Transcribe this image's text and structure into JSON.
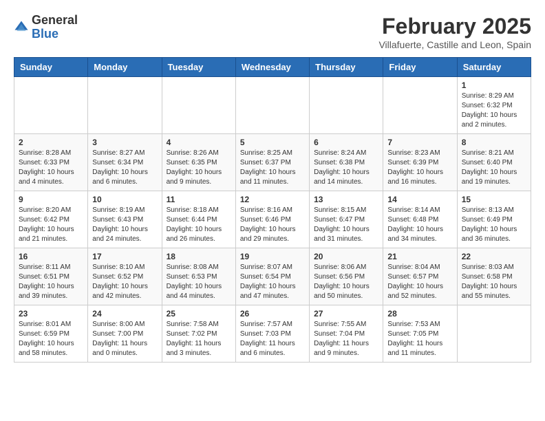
{
  "header": {
    "logo_general": "General",
    "logo_blue": "Blue",
    "month_year": "February 2025",
    "location": "Villafuerte, Castille and Leon, Spain"
  },
  "weekdays": [
    "Sunday",
    "Monday",
    "Tuesday",
    "Wednesday",
    "Thursday",
    "Friday",
    "Saturday"
  ],
  "weeks": [
    [
      {
        "day": "",
        "info": ""
      },
      {
        "day": "",
        "info": ""
      },
      {
        "day": "",
        "info": ""
      },
      {
        "day": "",
        "info": ""
      },
      {
        "day": "",
        "info": ""
      },
      {
        "day": "",
        "info": ""
      },
      {
        "day": "1",
        "info": "Sunrise: 8:29 AM\nSunset: 6:32 PM\nDaylight: 10 hours and 2 minutes."
      }
    ],
    [
      {
        "day": "2",
        "info": "Sunrise: 8:28 AM\nSunset: 6:33 PM\nDaylight: 10 hours and 4 minutes."
      },
      {
        "day": "3",
        "info": "Sunrise: 8:27 AM\nSunset: 6:34 PM\nDaylight: 10 hours and 6 minutes."
      },
      {
        "day": "4",
        "info": "Sunrise: 8:26 AM\nSunset: 6:35 PM\nDaylight: 10 hours and 9 minutes."
      },
      {
        "day": "5",
        "info": "Sunrise: 8:25 AM\nSunset: 6:37 PM\nDaylight: 10 hours and 11 minutes."
      },
      {
        "day": "6",
        "info": "Sunrise: 8:24 AM\nSunset: 6:38 PM\nDaylight: 10 hours and 14 minutes."
      },
      {
        "day": "7",
        "info": "Sunrise: 8:23 AM\nSunset: 6:39 PM\nDaylight: 10 hours and 16 minutes."
      },
      {
        "day": "8",
        "info": "Sunrise: 8:21 AM\nSunset: 6:40 PM\nDaylight: 10 hours and 19 minutes."
      }
    ],
    [
      {
        "day": "9",
        "info": "Sunrise: 8:20 AM\nSunset: 6:42 PM\nDaylight: 10 hours and 21 minutes."
      },
      {
        "day": "10",
        "info": "Sunrise: 8:19 AM\nSunset: 6:43 PM\nDaylight: 10 hours and 24 minutes."
      },
      {
        "day": "11",
        "info": "Sunrise: 8:18 AM\nSunset: 6:44 PM\nDaylight: 10 hours and 26 minutes."
      },
      {
        "day": "12",
        "info": "Sunrise: 8:16 AM\nSunset: 6:46 PM\nDaylight: 10 hours and 29 minutes."
      },
      {
        "day": "13",
        "info": "Sunrise: 8:15 AM\nSunset: 6:47 PM\nDaylight: 10 hours and 31 minutes."
      },
      {
        "day": "14",
        "info": "Sunrise: 8:14 AM\nSunset: 6:48 PM\nDaylight: 10 hours and 34 minutes."
      },
      {
        "day": "15",
        "info": "Sunrise: 8:13 AM\nSunset: 6:49 PM\nDaylight: 10 hours and 36 minutes."
      }
    ],
    [
      {
        "day": "16",
        "info": "Sunrise: 8:11 AM\nSunset: 6:51 PM\nDaylight: 10 hours and 39 minutes."
      },
      {
        "day": "17",
        "info": "Sunrise: 8:10 AM\nSunset: 6:52 PM\nDaylight: 10 hours and 42 minutes."
      },
      {
        "day": "18",
        "info": "Sunrise: 8:08 AM\nSunset: 6:53 PM\nDaylight: 10 hours and 44 minutes."
      },
      {
        "day": "19",
        "info": "Sunrise: 8:07 AM\nSunset: 6:54 PM\nDaylight: 10 hours and 47 minutes."
      },
      {
        "day": "20",
        "info": "Sunrise: 8:06 AM\nSunset: 6:56 PM\nDaylight: 10 hours and 50 minutes."
      },
      {
        "day": "21",
        "info": "Sunrise: 8:04 AM\nSunset: 6:57 PM\nDaylight: 10 hours and 52 minutes."
      },
      {
        "day": "22",
        "info": "Sunrise: 8:03 AM\nSunset: 6:58 PM\nDaylight: 10 hours and 55 minutes."
      }
    ],
    [
      {
        "day": "23",
        "info": "Sunrise: 8:01 AM\nSunset: 6:59 PM\nDaylight: 10 hours and 58 minutes."
      },
      {
        "day": "24",
        "info": "Sunrise: 8:00 AM\nSunset: 7:00 PM\nDaylight: 11 hours and 0 minutes."
      },
      {
        "day": "25",
        "info": "Sunrise: 7:58 AM\nSunset: 7:02 PM\nDaylight: 11 hours and 3 minutes."
      },
      {
        "day": "26",
        "info": "Sunrise: 7:57 AM\nSunset: 7:03 PM\nDaylight: 11 hours and 6 minutes."
      },
      {
        "day": "27",
        "info": "Sunrise: 7:55 AM\nSunset: 7:04 PM\nDaylight: 11 hours and 9 minutes."
      },
      {
        "day": "28",
        "info": "Sunrise: 7:53 AM\nSunset: 7:05 PM\nDaylight: 11 hours and 11 minutes."
      },
      {
        "day": "",
        "info": ""
      }
    ]
  ]
}
